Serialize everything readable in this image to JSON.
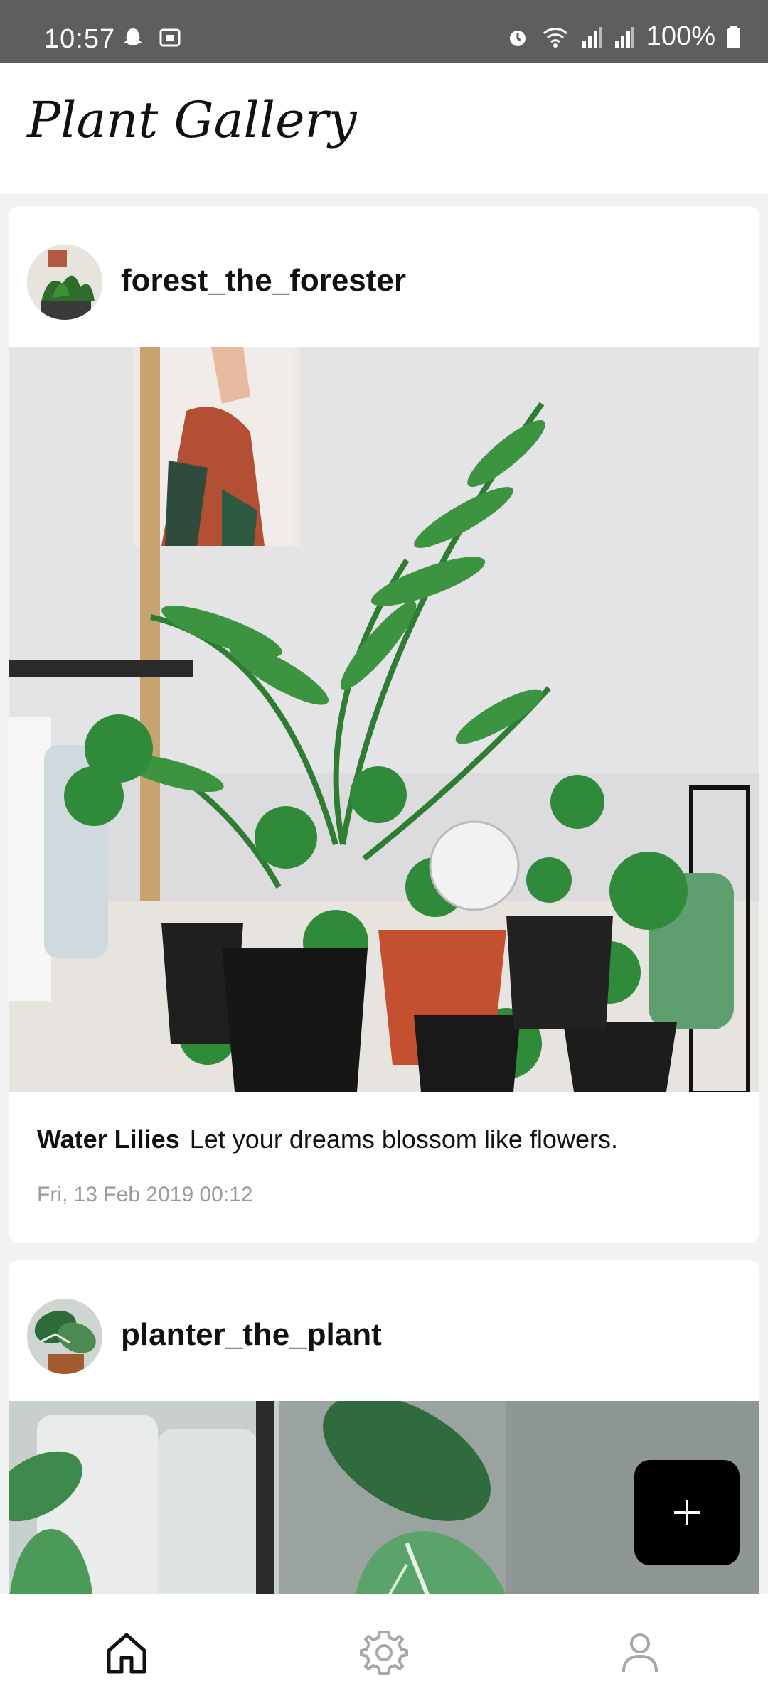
{
  "status_bar": {
    "time": "10:57",
    "battery": "100%",
    "icons": [
      "snapchat-icon",
      "screenshot-icon",
      "alarm-icon",
      "wifi-icon",
      "signal-icon",
      "signal-icon",
      "battery-icon"
    ]
  },
  "header": {
    "title": "Plant Gallery"
  },
  "posts": [
    {
      "username": "forest_the_forester",
      "title": "Water Lilies",
      "caption": "Let your dreams blossom like flowers.",
      "timestamp": "Fri, 13 Feb 2019 00:12"
    },
    {
      "username": "planter_the_plant"
    }
  ],
  "fab": {
    "icon": "plus-icon"
  },
  "nav": {
    "items": [
      {
        "icon": "home-icon",
        "active": true
      },
      {
        "icon": "gear-icon",
        "active": false
      },
      {
        "icon": "user-icon",
        "active": false
      }
    ]
  },
  "colors": {
    "accent": "#000000",
    "background": "#f2f2f2",
    "muted": "#9b9b9b"
  }
}
